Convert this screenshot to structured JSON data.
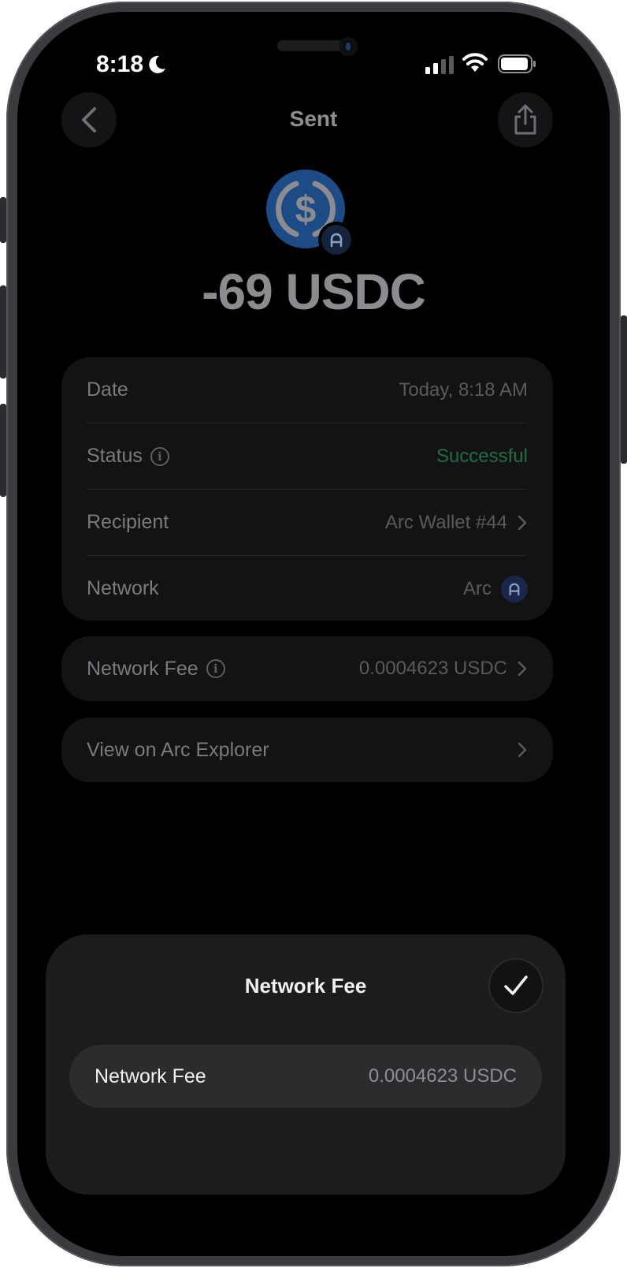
{
  "status_bar": {
    "time": "8:18",
    "icons": [
      "moon-icon",
      "signal-icon",
      "wifi-icon",
      "battery-icon"
    ]
  },
  "header": {
    "title": "Sent",
    "back_icon": "chevron-left-icon",
    "share_icon": "share-icon"
  },
  "transaction": {
    "amount": "-69 USDC",
    "token_icon": "usdc-icon",
    "network_badge_icon": "arc-icon"
  },
  "details": {
    "date_label": "Date",
    "date_value": "Today, 8:18 AM",
    "status_label": "Status",
    "status_value": "Successful",
    "recipient_label": "Recipient",
    "recipient_value": "Arc Wallet #44",
    "network_label": "Network",
    "network_value": "Arc"
  },
  "fee": {
    "label": "Network Fee",
    "value": "0.0004623 USDC"
  },
  "explorer": {
    "label": "View on Arc Explorer"
  },
  "sheet": {
    "title": "Network Fee",
    "row_label": "Network Fee",
    "row_value": "0.0004623 USDC"
  },
  "colors": {
    "success": "#1e6e46",
    "usdc_blue": "#1d4b85",
    "sheet_bg": "#1c1c1e"
  }
}
